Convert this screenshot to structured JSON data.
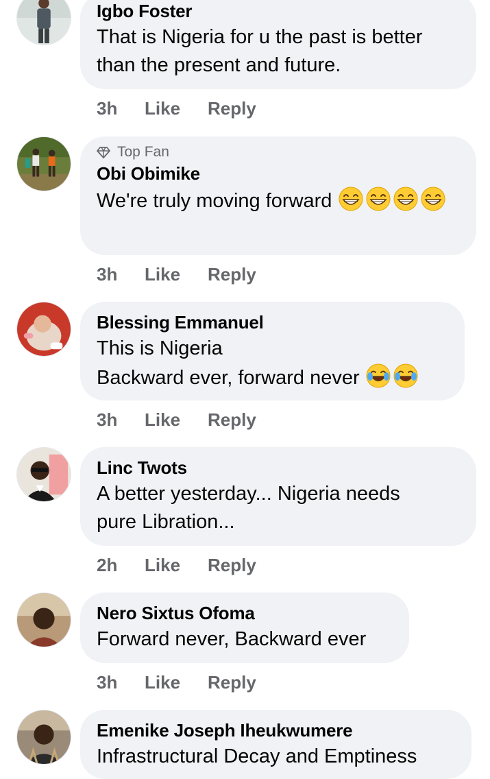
{
  "comments": [
    {
      "author": "Igbo Foster",
      "badge": "",
      "lines": [
        "That is Nigeria for u the past is better",
        "than the present and future."
      ],
      "emoji": [],
      "time": "3h",
      "like": "Like",
      "reply": "Reply"
    },
    {
      "author": "Obi Obimike",
      "badge": "Top Fan",
      "lines": [
        "We're truly moving forward"
      ],
      "emoji": [
        "grinning-face-emoji",
        "grinning-face-emoji",
        "grinning-face-emoji",
        "grinning-face-emoji"
      ],
      "time": "3h",
      "like": "Like",
      "reply": "Reply"
    },
    {
      "author": "Blessing Emmanuel",
      "badge": "",
      "lines": [
        "This is Nigeria",
        "Backward ever, forward never"
      ],
      "emoji": [
        "tears-of-joy-emoji",
        "tears-of-joy-emoji"
      ],
      "time": "3h",
      "like": "Like",
      "reply": "Reply"
    },
    {
      "author": "Linc Twots",
      "badge": "",
      "lines": [
        "A better yesterday... Nigeria needs",
        "pure Libration..."
      ],
      "emoji": [],
      "time": "2h",
      "like": "Like",
      "reply": "Reply"
    },
    {
      "author": "Nero Sixtus Ofoma",
      "badge": "",
      "lines": [
        "Forward never, Backward ever"
      ],
      "emoji": [],
      "time": "3h",
      "like": "Like",
      "reply": "Reply"
    },
    {
      "author": "Emenike Joseph Iheukwumere",
      "badge": "",
      "lines": [
        "Infrastructural Decay and Emptiness"
      ],
      "emoji": [],
      "time": "",
      "like": "",
      "reply": ""
    }
  ],
  "colors": {
    "bubble": "#f0f2f5",
    "secondary_text": "#65676b",
    "primary_text": "#050505"
  }
}
